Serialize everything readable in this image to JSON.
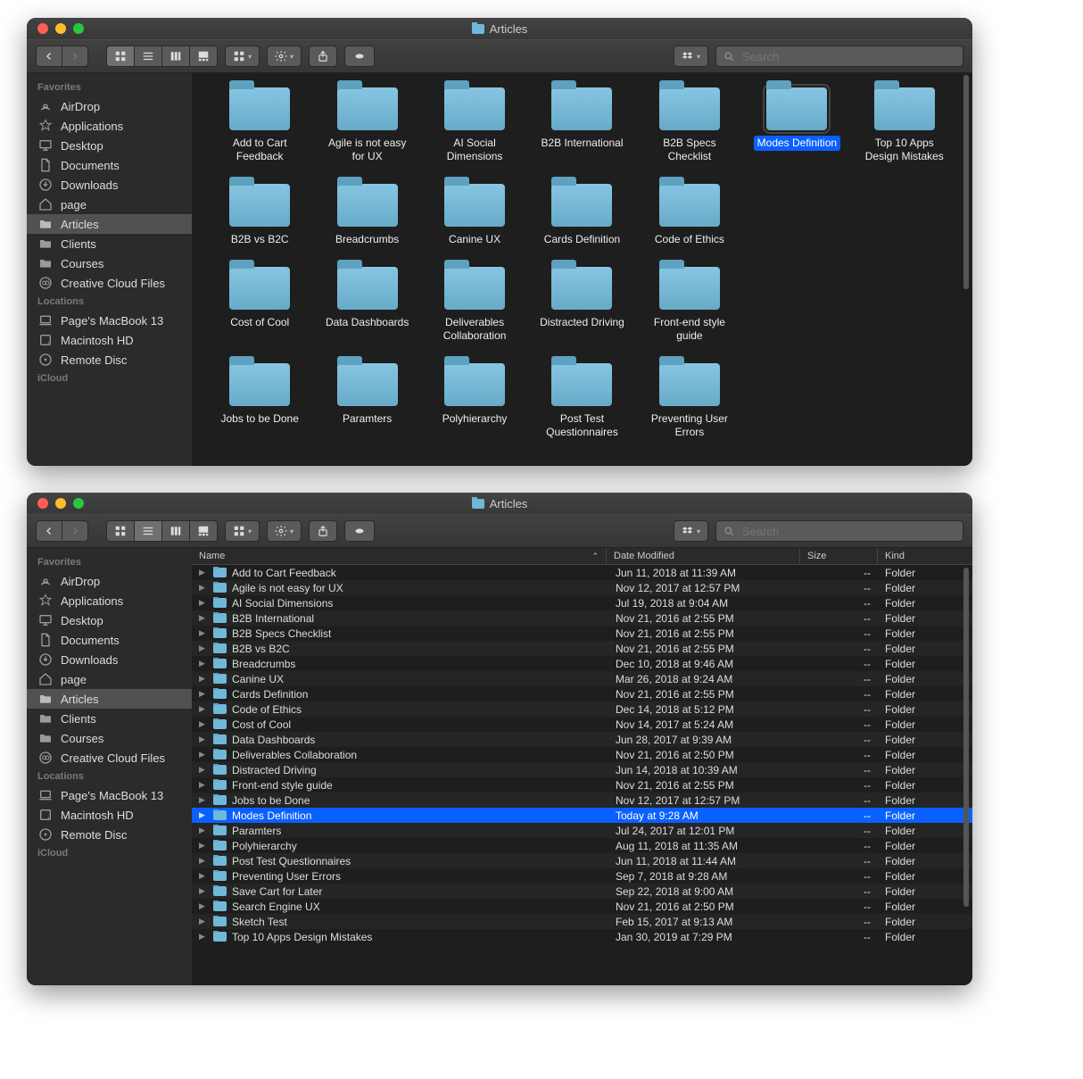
{
  "title": "Articles",
  "search_placeholder": "Search",
  "sidebar": {
    "sections": [
      {
        "heading": "Favorites",
        "items": [
          {
            "icon": "airdrop",
            "label": "AirDrop"
          },
          {
            "icon": "apps",
            "label": "Applications"
          },
          {
            "icon": "desktop",
            "label": "Desktop"
          },
          {
            "icon": "docs",
            "label": "Documents"
          },
          {
            "icon": "downloads",
            "label": "Downloads"
          },
          {
            "icon": "home",
            "label": "page"
          },
          {
            "icon": "folder",
            "label": "Articles",
            "active": true
          },
          {
            "icon": "folder",
            "label": "Clients"
          },
          {
            "icon": "folder",
            "label": "Courses"
          },
          {
            "icon": "cc",
            "label": "Creative Cloud Files"
          }
        ]
      },
      {
        "heading": "Locations",
        "items": [
          {
            "icon": "laptop",
            "label": "Page's MacBook 13"
          },
          {
            "icon": "hdd",
            "label": "Macintosh HD"
          },
          {
            "icon": "disc",
            "label": "Remote Disc"
          }
        ]
      },
      {
        "heading": "iCloud",
        "items": []
      }
    ]
  },
  "iconview": {
    "selected": "Modes Definition",
    "items": [
      "Add to Cart Feedback",
      "Agile is not easy for UX",
      "AI Social Dimensions",
      "B2B International",
      "B2B Specs Checklist",
      "Modes Definition",
      "Top 10 Apps Design Mistakes",
      "B2B vs B2C",
      "Breadcrumbs",
      "Canine UX",
      "Cards Definition",
      "Code of Ethics",
      "",
      "",
      "Cost of Cool",
      "Data Dashboards",
      "Deliverables Collaboration",
      "Distracted Driving",
      "Front-end style guide",
      "",
      "",
      "Jobs to be Done",
      "Paramters",
      "Polyhierarchy",
      "Post Test Questionnaires",
      "Preventing User Errors",
      "",
      "",
      "",
      "",
      "",
      "",
      "",
      "",
      ""
    ]
  },
  "listview": {
    "columns": {
      "name": "Name",
      "date": "Date Modified",
      "size": "Size",
      "kind": "Kind"
    },
    "size_placeholder": "--",
    "kind_value": "Folder",
    "selected": "Modes Definition",
    "rows": [
      {
        "name": "Add to Cart Feedback",
        "date": "Jun 11, 2018 at 11:39 AM"
      },
      {
        "name": "Agile is not easy for UX",
        "date": "Nov 12, 2017 at 12:57 PM"
      },
      {
        "name": "AI Social Dimensions",
        "date": "Jul 19, 2018 at 9:04 AM"
      },
      {
        "name": "B2B International",
        "date": "Nov 21, 2016 at 2:55 PM"
      },
      {
        "name": "B2B Specs Checklist",
        "date": "Nov 21, 2016 at 2:55 PM"
      },
      {
        "name": "B2B vs B2C",
        "date": "Nov 21, 2016 at 2:55 PM"
      },
      {
        "name": "Breadcrumbs",
        "date": "Dec 10, 2018 at 9:46 AM"
      },
      {
        "name": "Canine UX",
        "date": "Mar 26, 2018 at 9:24 AM"
      },
      {
        "name": "Cards Definition",
        "date": "Nov 21, 2016 at 2:55 PM"
      },
      {
        "name": "Code of Ethics",
        "date": "Dec 14, 2018 at 5:12 PM"
      },
      {
        "name": "Cost of Cool",
        "date": "Nov 14, 2017 at 5:24 AM"
      },
      {
        "name": "Data Dashboards",
        "date": "Jun 28, 2017 at 9:39 AM"
      },
      {
        "name": "Deliverables Collaboration",
        "date": "Nov 21, 2016 at 2:50 PM"
      },
      {
        "name": "Distracted Driving",
        "date": "Jun 14, 2018 at 10:39 AM"
      },
      {
        "name": "Front-end style guide",
        "date": "Nov 21, 2016 at 2:55 PM"
      },
      {
        "name": "Jobs to be Done",
        "date": "Nov 12, 2017 at 12:57 PM"
      },
      {
        "name": "Modes Definition",
        "date": "Today at 9:28 AM"
      },
      {
        "name": "Paramters",
        "date": "Jul 24, 2017 at 12:01 PM"
      },
      {
        "name": "Polyhierarchy",
        "date": "Aug 11, 2018 at 11:35 AM"
      },
      {
        "name": "Post Test Questionnaires",
        "date": "Jun 11, 2018 at 11:44 AM"
      },
      {
        "name": "Preventing User Errors",
        "date": "Sep 7, 2018 at 9:28 AM"
      },
      {
        "name": "Save Cart for Later",
        "date": "Sep 22, 2018 at 9:00 AM"
      },
      {
        "name": "Search Engine UX",
        "date": "Nov 21, 2016 at 2:50 PM"
      },
      {
        "name": "Sketch Test",
        "date": "Feb 15, 2017 at 9:13 AM"
      },
      {
        "name": "Top 10 Apps Design Mistakes",
        "date": "Jan 30, 2019 at 7:29 PM"
      }
    ]
  }
}
